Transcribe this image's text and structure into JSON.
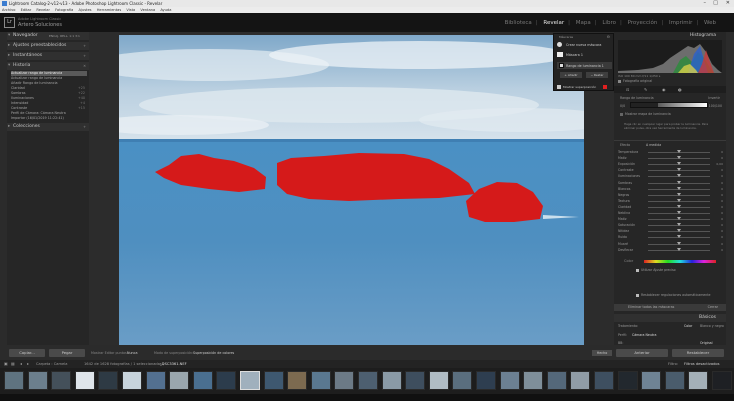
{
  "window": {
    "title": "Lightroom Catalog-2-v12-v13 - Adobe Photoshop Lightroom Classic - Revelar"
  },
  "menu": [
    "Archivo",
    "Editar",
    "Revelar",
    "Fotografía",
    "Ajustes",
    "Herramientas",
    "Vista",
    "Ventana",
    "Ayuda"
  ],
  "identity": {
    "line1": "Adobe Lightroom Classic",
    "line2": "Artero Soluciones",
    "logo": "Lr"
  },
  "modules": [
    "Biblioteca",
    "Revelar",
    "Mapa",
    "Libro",
    "Proyección",
    "Imprimir",
    "Web"
  ],
  "active_module": "Revelar",
  "left_panel": {
    "navigator": "Navegador",
    "nav_buttons": "ENCAJ.  RELL.  1:1  3:1",
    "presets": "Ajustes preestablecidos",
    "snapshots": "Instantáneos",
    "history": "Historia",
    "history_items": [
      {
        "label": "Actualizar rango de luminancia",
        "value": ""
      },
      {
        "label": "Actualizar rango de luminancia",
        "value": ""
      },
      {
        "label": "Añadir Rango de luminancia",
        "value": ""
      },
      {
        "label": "Claridad",
        "value": "+25"
      },
      {
        "label": "Sombras",
        "value": "+22"
      },
      {
        "label": "Iluminaciones",
        "value": "+40"
      },
      {
        "label": "Intensidad",
        "value": "+4"
      },
      {
        "label": "Contraste",
        "value": "+15"
      },
      {
        "label": "Perfil de Cámara: Cámara Neutra",
        "value": ""
      },
      {
        "label": "Importar (16/01/2019 11:22:41)",
        "value": ""
      }
    ],
    "collections": "Colecciones",
    "copy_button": "Copiar...",
    "paste_button": "Pegar"
  },
  "mask_panel": {
    "title": "Máscaras",
    "create": "Crear nueva máscara",
    "mask1": "Máscara 1",
    "luminance_range": "Rango de luminancia 1",
    "add": "+ Añadir",
    "subtract": "− Restar",
    "show_overlay": "Mostrar superposición"
  },
  "right_panel": {
    "histogram": "Histograma",
    "histo_info": "ISO 100   80 mm   f/11   1/250 s",
    "original_photo": "Fotografía original",
    "lum_range_label": "Rango de luminancia",
    "invert": "Invertir",
    "lum_value_left": "0/0",
    "lum_value_right": "100/100",
    "lum_slider_fill": 0.35,
    "show_lum_map": "Mostrar mapa de luminancia",
    "hint": "Haga clic en cualquier lugar para probar la luminancia. Para eliminar pulse, otra vez herramienta de luminancia.",
    "effect": "Efecto",
    "effect_value": "A medida",
    "sliders": [
      {
        "label": "Temperatura",
        "value": "0",
        "pos": 0.5
      },
      {
        "label": "Matiz",
        "value": "0",
        "pos": 0.5
      },
      {
        "label": "Exposición",
        "value": "0,00",
        "pos": 0.5
      },
      {
        "label": "Contraste",
        "value": "0",
        "pos": 0.5
      },
      {
        "label": "Iluminaciones",
        "value": "0",
        "pos": 0.5
      },
      {
        "label": "Sombras",
        "value": "0",
        "pos": 0.5
      },
      {
        "label": "Blancos",
        "value": "0",
        "pos": 0.5
      },
      {
        "label": "Negros",
        "value": "0",
        "pos": 0.5
      },
      {
        "label": "Textura",
        "value": "0",
        "pos": 0.5
      },
      {
        "label": "Claridad",
        "value": "0",
        "pos": 0.5
      },
      {
        "label": "Neblina",
        "value": "0",
        "pos": 0.5
      },
      {
        "label": "Matiz",
        "value": "0",
        "pos": 0.5
      },
      {
        "label": "Saturación",
        "value": "0",
        "pos": 0.5
      },
      {
        "label": "Nitidez",
        "value": "0",
        "pos": 0.5
      },
      {
        "label": "Ruido",
        "value": "0",
        "pos": 0.5
      },
      {
        "label": "Muaré",
        "value": "0",
        "pos": 0.5
      },
      {
        "label": "Desflecar",
        "value": "0",
        "pos": 0.5
      }
    ],
    "use_fine": "Utilizar Ajuste preciso",
    "reset_sliders": "Restablecer regulaciones automáticamente",
    "delete_all": "Eliminar todas las máscaras",
    "close": "Cerrar",
    "basics": "Básicos",
    "treatment": "Tratamiento:",
    "color": "Color",
    "bw": "Blanco y negro",
    "profile_label": "Perfil:",
    "profile": "Cámara Neutra",
    "wb_label": "BB:",
    "wb_value": "Original",
    "previous": "Anterior",
    "reset": "Restablecer"
  },
  "toolbar": {
    "show_edit_pins": "Mostrar Editar puntos:",
    "pins_value": "Nunca",
    "overlay_label": "Modo de superposición:",
    "overlay_value": "Superposición de colores",
    "done": "Hecho"
  },
  "filmstrip": {
    "path": "Carpeta : Camela",
    "count": "1642 de 1628 fotografías / 1 seleccionadas /",
    "file": "_DSC3361.NEF",
    "filter": "Filtro:",
    "filter_value": "Filtros desactivados"
  }
}
